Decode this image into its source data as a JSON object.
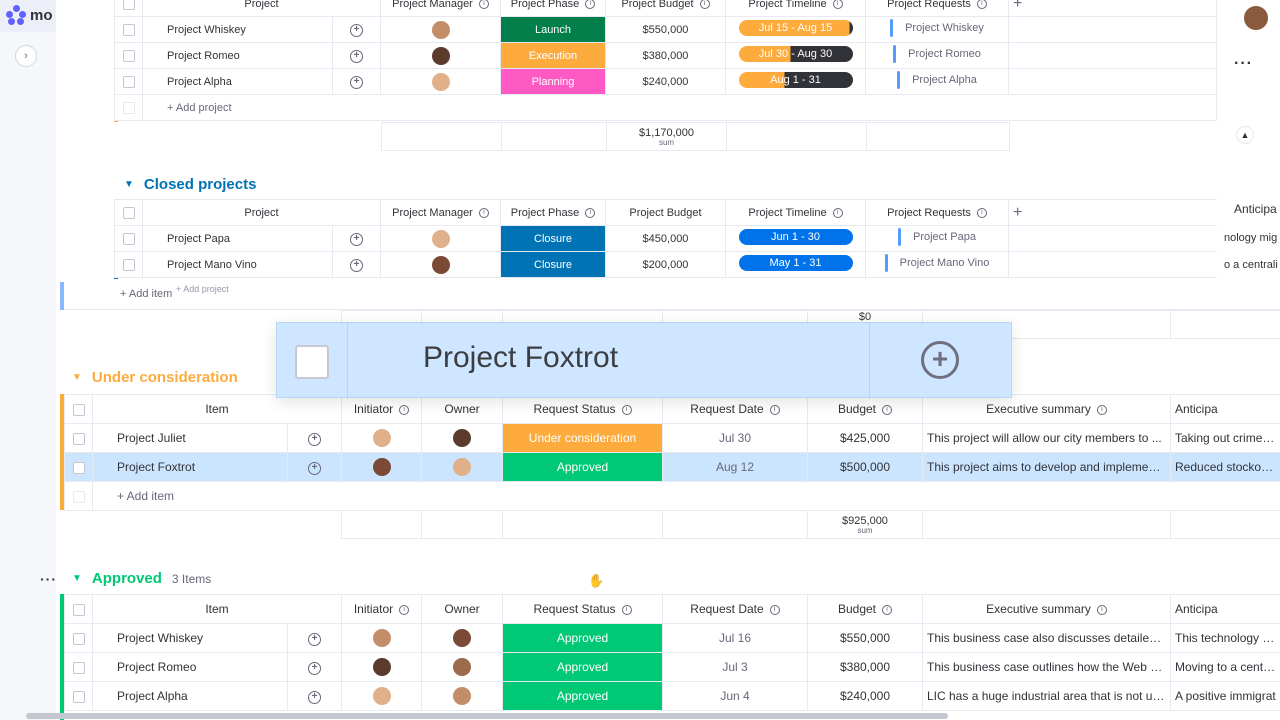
{
  "app": {
    "logo_text": "mo"
  },
  "colors": {
    "launch": "#037f4c",
    "execution": "#fdab3d",
    "planning": "#ff5ac4",
    "closure": "#0073b5",
    "under_consideration": "#fdab3d",
    "approved": "#00c875",
    "timeline_blue": "#0073ea",
    "timeline_orange": "#fdab3d",
    "group_orange": "#fdab3d",
    "group_blue": "#0073b5",
    "group_green": "#00c875",
    "group_lightblue": "#579bfc"
  },
  "top_group": {
    "columns": [
      "Project",
      "Project Manager",
      "Project Phase",
      "Project Budget",
      "Project Timeline",
      "Project Requests"
    ],
    "add_column": "+",
    "rows": [
      {
        "name": "Project Whiskey",
        "phase": "Launch",
        "phase_color": "#037f4c",
        "budget": "$550,000",
        "timeline": "Jul 15 - Aug 15",
        "timeline_progress": 0.97,
        "request": "Project Whiskey"
      },
      {
        "name": "Project Romeo",
        "phase": "Execution",
        "phase_color": "#fdab3d",
        "budget": "$380,000",
        "timeline": "Jul 30 - Aug 30",
        "timeline_progress": 0.45,
        "request": "Project Romeo"
      },
      {
        "name": "Project Alpha",
        "phase": "Planning",
        "phase_color": "#ff5ac4",
        "budget": "$240,000",
        "timeline": "Aug 1 - 31",
        "timeline_progress": 0.4,
        "request": "Project Alpha"
      }
    ],
    "add_label": "+ Add project",
    "sum_value": "$1,170,000",
    "sum_label": "sum"
  },
  "closed_group": {
    "title": "Closed projects",
    "columns": [
      "Project",
      "Project Manager",
      "Project Phase",
      "Project Budget",
      "Project Timeline",
      "Project Requests"
    ],
    "add_column": "+",
    "right_col": "Anticipa",
    "rows": [
      {
        "name": "Project Papa",
        "phase": "Closure",
        "budget": "$450,000",
        "timeline": "Jun 1 - 30",
        "request": "Project Papa",
        "right": "nology mig"
      },
      {
        "name": "Project Mano Vino",
        "phase": "Closure",
        "budget": "$200,000",
        "timeline": "May 1 - 31",
        "request": "Project Mano Vino",
        "right": "o a centrali"
      }
    ],
    "add_label": "+ Add item",
    "add_ghost": "+ Add project",
    "sum_value": "$0"
  },
  "drag_card": {
    "name": "Project Foxtrot"
  },
  "consideration_group": {
    "title": "Under consideration",
    "columns": [
      "Item",
      "Initiator",
      "Owner",
      "Request Status",
      "Request Date",
      "Budget",
      "Executive summary",
      "Anticipa"
    ],
    "rows": [
      {
        "name": "Project Juliet",
        "status": "Under consideration",
        "status_color": "#fdab3d",
        "date": "Jul 30",
        "budget": "$425,000",
        "summary": "This project will allow our city members to ...",
        "anticipated": "Taking out crime, op"
      },
      {
        "name": "Project Foxtrot",
        "status": "Approved",
        "status_color": "#00c875",
        "date": "Aug 12",
        "budget": "$500,000",
        "summary": "This project aims to develop and implement...",
        "anticipated": "Reduced stockouts:"
      }
    ],
    "add_label": "+ Add item",
    "sum_value": "$925,000",
    "sum_label": "sum"
  },
  "approved_group": {
    "title": "Approved",
    "count": "3 Items",
    "columns": [
      "Item",
      "Initiator",
      "Owner",
      "Request Status",
      "Request Date",
      "Budget",
      "Executive summary",
      "Anticipa"
    ],
    "rows": [
      {
        "name": "Project Whiskey",
        "status": "Approved",
        "date": "Jul 16",
        "budget": "$550,000",
        "summary": "This business case also discusses detailed pr...",
        "anticipated": "This technology mig"
      },
      {
        "name": "Project Romeo",
        "status": "Approved",
        "date": "Jul 3",
        "budget": "$380,000",
        "summary": "This business case outlines how the Web Pl...",
        "anticipated": "Moving to a centrali"
      },
      {
        "name": "Project Alpha",
        "status": "Approved",
        "date": "Jun 4",
        "budget": "$240,000",
        "summary": "LIC has a huge industrial area that is not use...",
        "anticipated": "A positive immigrat"
      }
    ]
  },
  "icons": {
    "update": "add-update-icon",
    "info": "info-icon",
    "menu": "more-dots-icon",
    "collapse": "chevron-right-icon",
    "cursor": "hand-cursor-icon"
  }
}
